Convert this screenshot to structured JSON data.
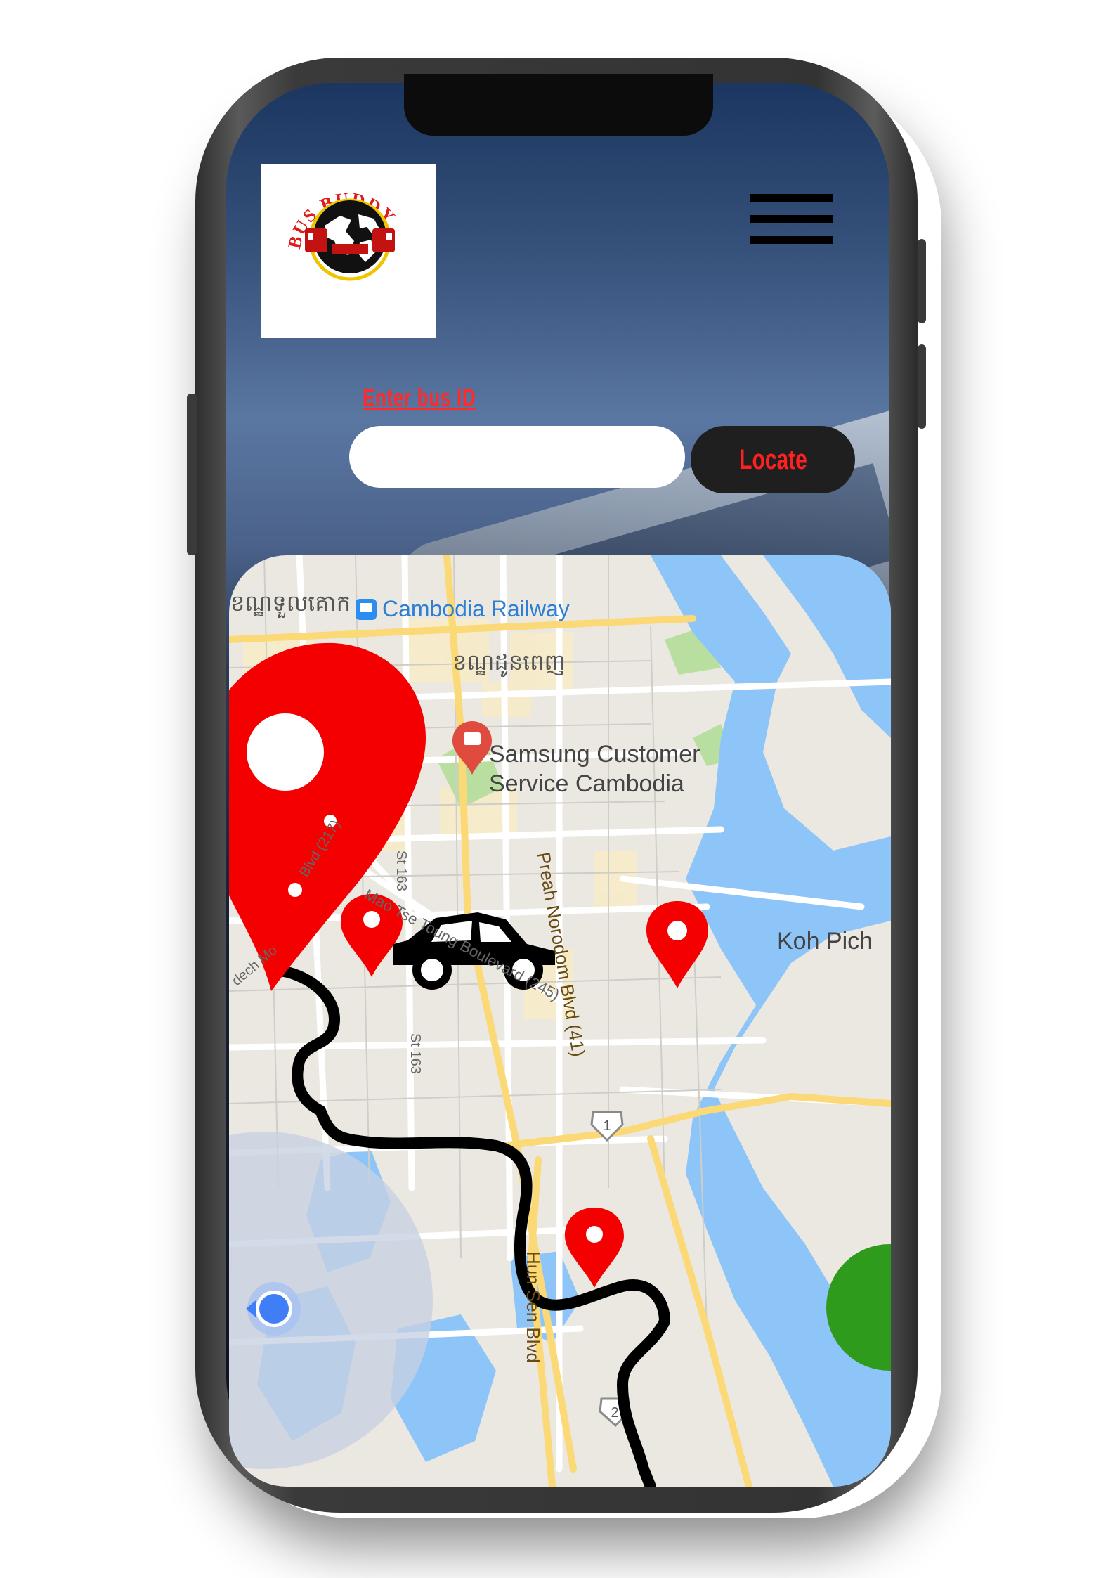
{
  "app": {
    "logo_text": "BUS BUDDY"
  },
  "search": {
    "label": "Enter bus  ID",
    "value": "",
    "placeholder": "",
    "button_label": "Locate"
  },
  "map": {
    "labels": {
      "district_west": "ខណ្ឌទួលគោក",
      "railway": "Cambodia Railway",
      "district_center": "ខណ្ឌដូនពេញ",
      "poi": "Samsung Customer Service Cambodia",
      "poi_line1": "Samsung Customer",
      "poi_line2": "Service Cambodia",
      "boulevard_217": "Blvd (217)",
      "mao_tse_tung": "Mao Tse Toung Boulevard (245)",
      "st_163_top": "St 163",
      "st_163_bottom": "St 163",
      "norodom": "Preah Norodom Blvd (41)",
      "hun_sen": "Hun Sen Blvd",
      "koh_pich": "Koh Pich",
      "road_1": "1",
      "road_2": "2",
      "sdech": "dech Mo"
    },
    "colors": {
      "pin": "#f40000",
      "route": "#000000",
      "water": "#8ec5f8",
      "park": "#b9dfa0",
      "location_dot": "#3f7ef6",
      "destination": "#2e9b1c"
    }
  }
}
